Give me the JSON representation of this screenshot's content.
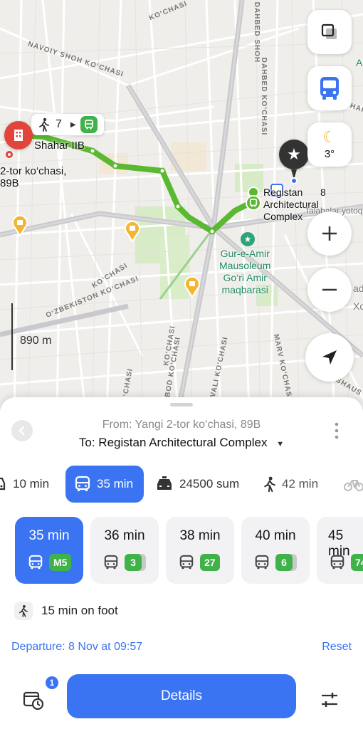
{
  "map": {
    "streets": {
      "navoiy": "NAVOIY SHOH KO‘CHASI",
      "kochasi_top": "KO‘CHASI",
      "dahbed1": "DAHBED SHOH",
      "dahbed2": "DAHBED KO‘CHASI",
      "shah": "SHAH",
      "uzbekiston": "O‘ZBEKISTON KO‘CHASI",
      "kochasi_left": "KO‘CHASI",
      "bod": "BOD KO‘CHASI",
      "ko_chasi": "KO‘CHASI",
      "vali": "VALI KO‘CHASI",
      "marv": "MARV KO‘CHASI",
      "shaus": "SHAUS",
      "xo": "Xo",
      "a_letter": "A",
      "adja": "adja"
    },
    "walk_bubble": {
      "minutes": "7"
    },
    "origin_label": "Shahar IIB",
    "origin_address": "2-tor ko‘chasi,\n89B",
    "dest_label": "Registan\nArchitectural\nComplex",
    "dest_number": "8",
    "dest_extra": "Talabalar yotoqxona",
    "poi_label": "Gur-e-Amir\nMausoleum\nGo‘ri Amir\nmaqbarasi",
    "weather": {
      "temp": "3°"
    },
    "scale": "890 m"
  },
  "sheet": {
    "from": "From: Yangi 2-tor ko‘chasi, 89B",
    "to": "To: Registan Architectural Complex",
    "modes": [
      {
        "name": "car",
        "label": "10 min"
      },
      {
        "name": "transit",
        "label": "35 min",
        "active": true
      },
      {
        "name": "taxi",
        "label": "24500 sum"
      },
      {
        "name": "walk",
        "label": "42 min"
      }
    ],
    "routes": [
      {
        "time": "35 min",
        "line": "M5",
        "active": true
      },
      {
        "time": "36 min",
        "line": "3"
      },
      {
        "time": "38 min",
        "line": "27"
      },
      {
        "time": "40 min",
        "line": "6"
      },
      {
        "time": "45 min",
        "line": "74"
      }
    ],
    "on_foot": "15 min on foot",
    "departure": "Departure: 8 Nov at 09:57",
    "reset": "Reset",
    "history_badge": "1",
    "details": "Details"
  },
  "colors": {
    "accent": "#3a74f2",
    "route_green": "#5ab831",
    "origin_red": "#e2443c",
    "badge_green": "#3fb24a"
  }
}
